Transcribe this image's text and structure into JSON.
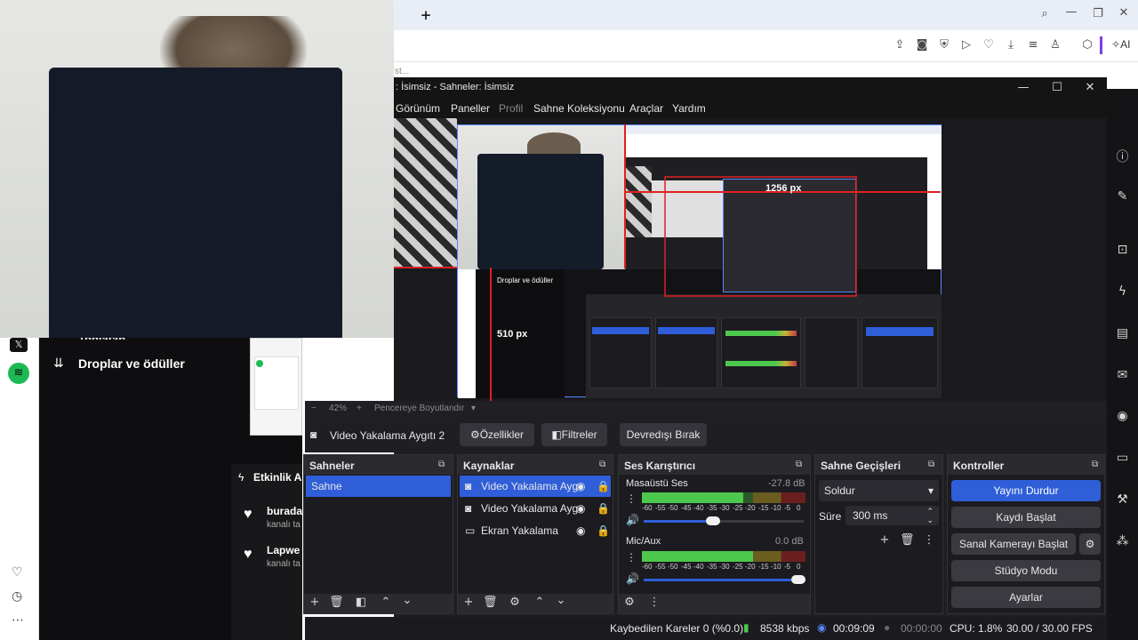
{
  "browser": {
    "new_tab_glyph": "+",
    "partial_text": "st...",
    "twitch_side": {
      "cut_header": "Toplatan",
      "drops_label": "Droplar ve ödüller",
      "activity_label": "Etkinlik A",
      "items": [
        {
          "title": "burada",
          "sub": "kanalı ta"
        },
        {
          "title": "Lapwe",
          "sub": "kanalı ta"
        }
      ]
    },
    "toolbar_right_label": "AI"
  },
  "obs": {
    "title": ": İsimsiz - Sahneler: İsimsiz",
    "menu": [
      "Görünüm",
      "Paneller",
      "Profil",
      "Sahne Koleksiyonu",
      "Araçlar",
      "Yardım"
    ],
    "preview": {
      "zoom": "42%",
      "fit_label": "Pencereye Boyutlandır",
      "measure_top": "1256 px",
      "measure_left": "510 px",
      "nested_drops": "Droplar ve ödüller"
    },
    "source_toolbar": {
      "source_name": "Video Yakalama Aygıtı 2",
      "properties": "Özellikler",
      "filters": "Filtreler",
      "deactivate": "Devredışı Bırak"
    },
    "scenes": {
      "title": "Sahneler",
      "items": [
        "Sahne"
      ]
    },
    "sources": {
      "title": "Kaynaklar",
      "items": [
        {
          "label": "Video Yakalama Ayg",
          "icon": "camera-icon"
        },
        {
          "label": "Video Yakalama Ayg",
          "icon": "camera-icon"
        },
        {
          "label": "Ekran Yakalama",
          "icon": "monitor-icon"
        }
      ]
    },
    "mixer": {
      "title": "Ses Karıştırıcı",
      "channels": [
        {
          "name": "Masaüstü Ses",
          "db": "-27.8 dB",
          "level": 0.62,
          "volume": 0.42
        },
        {
          "name": "Mic/Aux",
          "db": "0.0 dB",
          "level": 0.68,
          "volume": 1.0
        }
      ],
      "scale": [
        "-60",
        "-55",
        "-50",
        "-45",
        "-40",
        "-35",
        "-30",
        "-25",
        "-20",
        "-15",
        "-10",
        "-5",
        "0"
      ]
    },
    "transitions": {
      "title": "Sahne Geçişleri",
      "selected": "Soldur",
      "duration_label": "Süre",
      "duration_value": "300 ms"
    },
    "controls": {
      "title": "Kontroller",
      "stop_stream": "Yayını Durdur",
      "start_record": "Kaydı Başlat",
      "virtual_cam": "Sanal Kamerayı Başlat",
      "studio_mode": "Stüdyo Modu",
      "settings": "Ayarlar"
    },
    "status": {
      "dropped": "Kaybedilen Kareler 0 (%0.0)",
      "bitrate": "8538 kbps",
      "stream_time": "00:09:09",
      "rec_time": "00:00:00",
      "cpu": "CPU: 1.8%",
      "fps": "30.00 / 30.00 FPS"
    },
    "colors": {
      "accent": "#2f5ed8",
      "meter_green": "#4cc94c",
      "meter_yellow": "#c9b13a",
      "meter_red": "#c23a3a"
    }
  }
}
